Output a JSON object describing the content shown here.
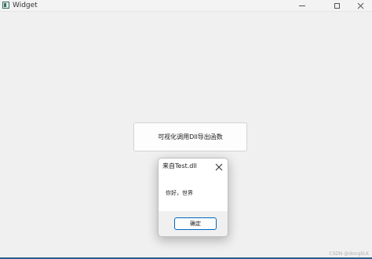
{
  "window": {
    "title": "Widget",
    "controls": {
      "minimize_icon": "minimize-icon",
      "maximize_icon": "maximize-icon",
      "close_icon": "close-icon"
    }
  },
  "main": {
    "button_label": "可视化调用Dll导出函数"
  },
  "dialog": {
    "title": "来自Test.dll",
    "message": "你好，世界",
    "ok_label": "确定",
    "close_icon": "close-icon"
  },
  "footer": {
    "watermark": "CSDN @dongliLK"
  },
  "colors": {
    "background": "#f0f0f0",
    "accent_border": "#0067c0"
  }
}
